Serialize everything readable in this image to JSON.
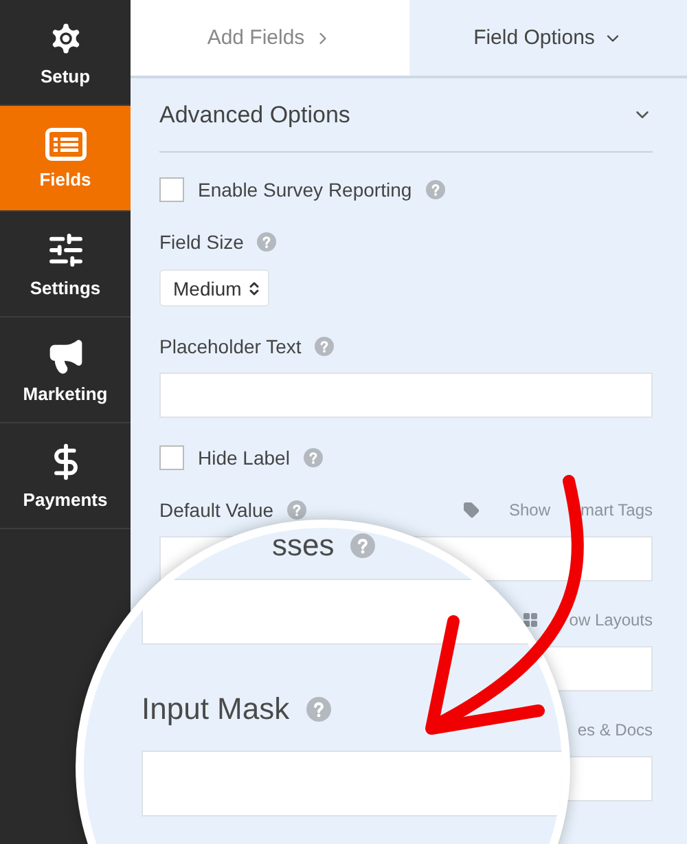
{
  "sidebar": {
    "items": [
      {
        "label": "Setup",
        "kind": "gear",
        "selected": false
      },
      {
        "label": "Fields",
        "kind": "list",
        "selected": true
      },
      {
        "label": "Settings",
        "kind": "sliders",
        "selected": false
      },
      {
        "label": "Marketing",
        "kind": "megaphone",
        "selected": false
      },
      {
        "label": "Payments",
        "kind": "dollar",
        "selected": false
      }
    ]
  },
  "tabs": [
    {
      "label": "Add Fields",
      "kind": "forward",
      "selected": false
    },
    {
      "label": "Field Options",
      "kind": "dropdown",
      "selected": true
    }
  ],
  "panel": {
    "title": "Advanced Options",
    "expanded": true
  },
  "options": [
    {
      "kind": "checkbox",
      "label": "Enable Survey Reporting",
      "checked": false
    },
    {
      "kind": "select",
      "label": "Field Size",
      "value": "Medium"
    },
    {
      "kind": "text",
      "label": "Placeholder Text"
    },
    {
      "kind": "checkbox",
      "label": "Hide Label",
      "checked": false
    },
    {
      "kind": "text",
      "label": "Default Value",
      "link": {
        "kind": "tag",
        "parts": [
          "Show",
          "mart Tags"
        ]
      }
    },
    {
      "kind": "text",
      "link": {
        "kind": "grid",
        "parts": [
          "ow Layouts"
        ]
      }
    },
    {
      "kind": "text",
      "link": {
        "kind": "plain",
        "parts": [
          "es & Docs"
        ]
      }
    }
  ],
  "magnifier": {
    "fields": [
      {
        "label": "sses"
      },
      {
        "label": "Input Mask"
      }
    ]
  }
}
